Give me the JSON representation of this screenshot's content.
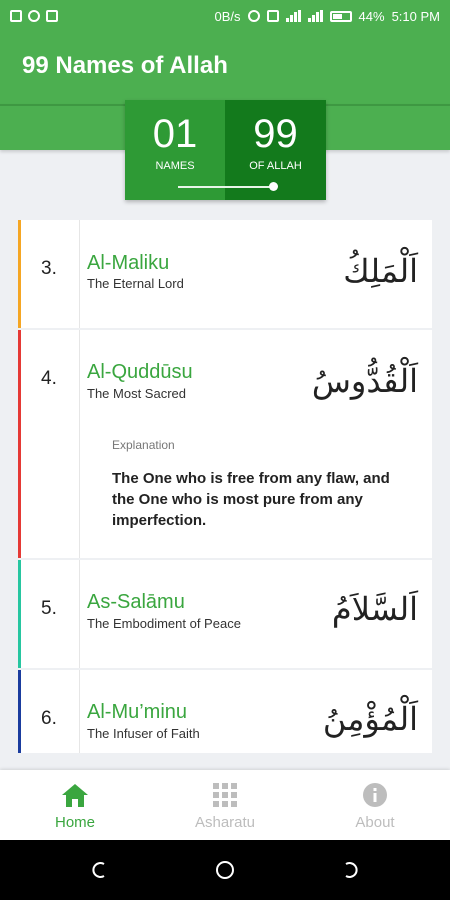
{
  "status_bar": {
    "network_speed": "0B/s",
    "battery_percent": "44%",
    "time": "5:10 PM"
  },
  "app_bar": {
    "title": "99 Names of Allah"
  },
  "counter": {
    "current_number": "01",
    "current_label": "NAMES",
    "total_number": "99",
    "total_label": "OF ALLAH",
    "slider_fraction": 0.97
  },
  "names": [
    {
      "number": "3.",
      "transliteration": "Al-Maliku",
      "meaning": "The Eternal Lord",
      "arabic": "اَلْمَلِكُ",
      "accent_color": "#f5a623"
    },
    {
      "number": "4.",
      "transliteration": "Al-Quddūsu",
      "meaning": "The Most Sacred",
      "arabic": "اَلْقُدُّوسُ",
      "accent_color": "#e53935",
      "explanation_label": "Explanation",
      "explanation": "The One who is free from any flaw, and the One who is most pure from any imperfection."
    },
    {
      "number": "5.",
      "transliteration": "As-Salāmu",
      "meaning": "The Embodiment of Peace",
      "arabic": "اَلسَّلاَمُ",
      "accent_color": "#26c6a0"
    },
    {
      "number": "6.",
      "transliteration": "Al-Mu’minu",
      "meaning": "The Infuser of Faith",
      "arabic": "اَلْمُؤْمِنُ",
      "accent_color": "#1a3c9e"
    }
  ],
  "bottom_nav": {
    "items": [
      {
        "label": "Home",
        "icon": "home-icon",
        "active": true
      },
      {
        "label": "Asharatu",
        "icon": "grid-icon",
        "active": false
      },
      {
        "label": "About",
        "icon": "info-icon",
        "active": false
      }
    ],
    "active_color": "#3aa63f",
    "inactive_color": "#bdbdbd"
  }
}
